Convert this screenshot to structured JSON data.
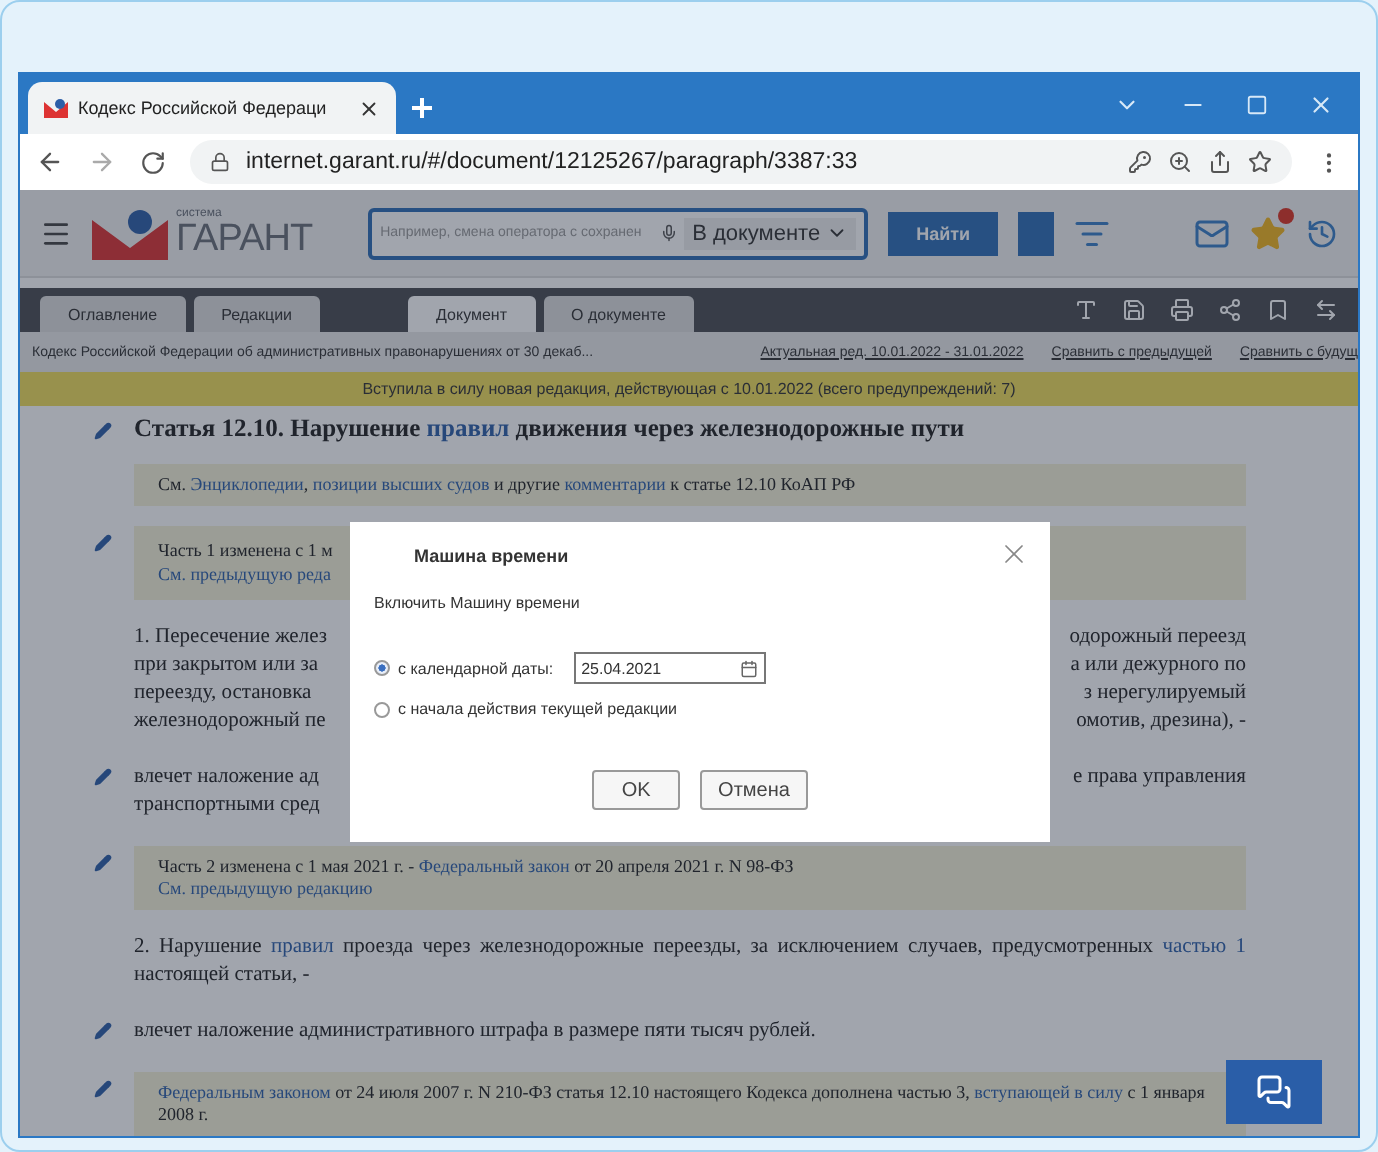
{
  "browser": {
    "tab_title": "Кодекс Российской Федераци",
    "url": "internet.garant.ru/#/document/12125267/paragraph/3387:33"
  },
  "header": {
    "logo_small": "система",
    "logo": "ГАРАНТ",
    "search_placeholder": "Например, смена оператора с сохранен",
    "scope": "В документе",
    "find_button": "Найти"
  },
  "doc_tabs": [
    {
      "label": "Оглавление",
      "selected": false
    },
    {
      "label": "Редакции",
      "selected": false
    },
    {
      "label": "Документ",
      "selected": true
    },
    {
      "label": "О документе",
      "selected": false
    }
  ],
  "info_bar": {
    "title": "Кодекс Российской Федерации об административных правонарушениях от 30 декаб...",
    "edition": "Актуальная ред. 10.01.2022 - 31.01.2022",
    "links": [
      "Сравнить с предыдущей",
      "Сравнить с будущ"
    ]
  },
  "banner": "Вступила в силу новая редакция, действующая с 10.01.2022 (всего предупреждений: 7)",
  "blocks": [
    {
      "kind": "heading",
      "pen": true,
      "segments": [
        {
          "text": "Статья 12.10. Нарушение ",
          "link": false
        },
        {
          "text": "правил",
          "link": true
        },
        {
          "text": " движения через железнодорожные пути",
          "link": false
        }
      ]
    },
    {
      "kind": "note",
      "pen": false,
      "lines": [
        [
          {
            "text": "См. ",
            "link": false
          },
          {
            "text": "Энциклопедии",
            "link": true
          },
          {
            "text": ", ",
            "link": false
          },
          {
            "text": "позиции высших судов",
            "link": true
          },
          {
            "text": " и другие ",
            "link": false
          },
          {
            "text": "комментарии",
            "link": true
          },
          {
            "text": " к статье 12.10 КоАП РФ",
            "link": false
          }
        ]
      ]
    },
    {
      "kind": "split_note",
      "pen": true,
      "left": [
        {
          "text": "Часть 1 изменена с 1 м",
          "link": false
        },
        {
          "text": "См. предыдущую реда",
          "link": true
        }
      ]
    },
    {
      "kind": "split_para",
      "pen": false,
      "left": [
        {
          "text": "1. Пересечение желез",
          "link": false
        },
        {
          "text": "при закрытом или за",
          "link": false
        },
        {
          "text": "переезду, остановка",
          "link": false
        },
        {
          "text": "железнодорожный пе",
          "link": false
        }
      ],
      "right": [
        {
          "text": "одорожный переезд",
          "link": false
        },
        {
          "text": "а или дежурного по",
          "link": false
        },
        {
          "text": "з нерегулируемый",
          "link": false
        },
        {
          "text": "омотив, дрезина), -",
          "link": false
        }
      ]
    },
    {
      "kind": "split_para",
      "pen": true,
      "left": [
        {
          "text": "влечет наложение ад",
          "link": false
        },
        {
          "text": "транспортными сред",
          "link": false
        }
      ],
      "right": [
        {
          "text": "е права управления",
          "link": false
        }
      ]
    },
    {
      "kind": "note",
      "pen": true,
      "lines": [
        [
          {
            "text": "Часть 2 изменена с 1 мая 2021 г. - ",
            "link": false
          },
          {
            "text": "Федеральный закон",
            "link": true
          },
          {
            "text": " от 20 апреля 2021 г. N 98-ФЗ",
            "link": false
          }
        ],
        [
          {
            "text": "См. предыдущую редакцию",
            "link": true
          }
        ]
      ]
    },
    {
      "kind": "para",
      "pen": false,
      "segments": [
        {
          "text": "2. Нарушение ",
          "link": false
        },
        {
          "text": "правил",
          "link": true
        },
        {
          "text": " проезда через железнодорожные переезды, за исключением случаев, предусмотренных ",
          "link": false
        },
        {
          "text": "частью 1",
          "link": true
        },
        {
          "text": " настоящей статьи, -",
          "link": false
        }
      ]
    },
    {
      "kind": "para",
      "pen": true,
      "segments": [
        {
          "text": "влечет наложение административного штрафа в размере пяти тысяч рублей.",
          "link": false
        }
      ]
    },
    {
      "kind": "note",
      "pen": true,
      "lines": [
        [
          {
            "text": "Федеральным законом",
            "link": true
          },
          {
            "text": " от 24 июля 2007 г. N 210-ФЗ статья 12.10 настоящего Кодекса дополнена частью 3, ",
            "link": false
          },
          {
            "text": "вступающей в силу",
            "link": true
          },
          {
            "text": " с 1 января 2008 г.",
            "link": false
          }
        ]
      ]
    }
  ],
  "dialog": {
    "title": "Машина времени",
    "subtitle": "Включить Машину времени",
    "options": [
      {
        "label": "с календарной даты:",
        "selected": true,
        "date": "25.04.2021"
      },
      {
        "label": "с начала действия текущей редакции",
        "selected": false
      }
    ],
    "buttons": [
      "OK",
      "Отмена"
    ]
  }
}
